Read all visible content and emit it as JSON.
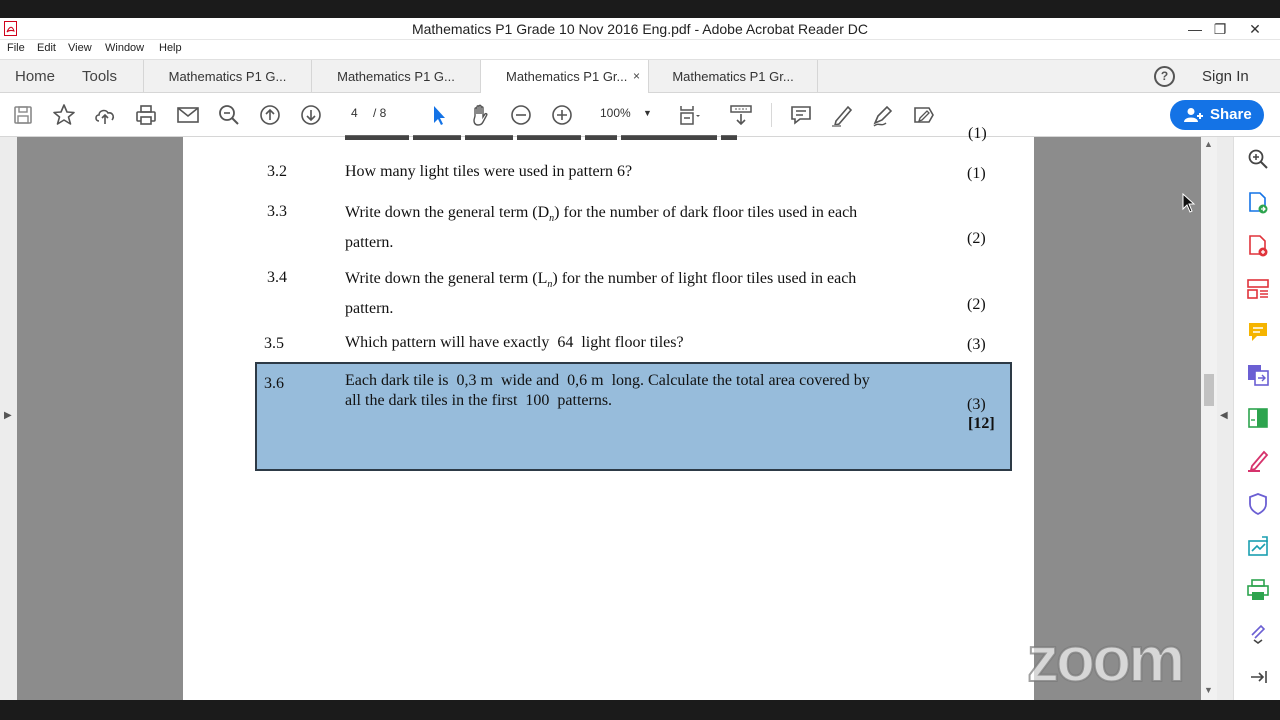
{
  "window": {
    "title": "Mathematics P1 Grade 10 Nov 2016 Eng.pdf - Adobe Acrobat Reader DC",
    "minimize": "—",
    "restore": "❐",
    "close": "✕"
  },
  "menu": [
    "File",
    "Edit",
    "View",
    "Window",
    "Help"
  ],
  "tabs": {
    "home": "Home",
    "tools": "Tools",
    "docs": [
      "Mathematics P1 G...",
      "Mathematics P1 G...",
      "Mathematics P1 Gr...",
      "Mathematics P1 Gr..."
    ],
    "close_glyph": "×",
    "help": "?",
    "signin": "Sign In"
  },
  "toolbar": {
    "page_current": "4",
    "page_total": "/ 8",
    "zoom": "100%",
    "share_label": "Share"
  },
  "document": {
    "q32": {
      "num": "3.2",
      "text": "How many light tiles were used in pattern 6?",
      "marks": "(1)"
    },
    "q33": {
      "num": "3.3",
      "line1": "Write down the general term",
      "term": "(D",
      "sub": "n",
      "line1b": ") for the number of dark floor tiles used in each",
      "line2": "pattern.",
      "marks": "(2)"
    },
    "q34": {
      "num": "3.4",
      "line1": "Write down the general term",
      "term": "(L",
      "sub": "n",
      "line1b": ") for the number of light floor tiles used in each",
      "line2": "pattern.",
      "marks": "(2)"
    },
    "q35": {
      "num": "3.5",
      "text": "Which pattern will have exactly  64  light floor tiles?",
      "marks": "(3)"
    },
    "q36": {
      "num": "3.6",
      "line1": "Each dark tile is  0,3 m  wide and  0,6 m  long. Calculate the total area covered by",
      "line2": "all the dark tiles in the first  100  patterns.",
      "marks": "(3)",
      "total": "[12]"
    }
  },
  "watermark": "zoom",
  "colors": {
    "accent": "#1473e6",
    "highlight": "#97bcdb"
  }
}
